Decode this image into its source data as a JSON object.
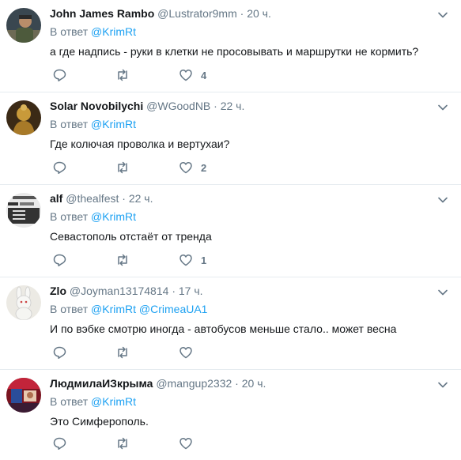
{
  "reply_prefix": "В ответ",
  "tweets": [
    {
      "name": "John James Rambo",
      "handle": "@Lustrator9mm",
      "dot": "·",
      "time": "20 ч.",
      "mentions": [
        "@KrimRt"
      ],
      "text": "а где надпись - руки в клетки не просовывать и маршрутки не кормить?",
      "likes": "4",
      "avatar": "person-in-dark-photo"
    },
    {
      "name": "Solar Novobilychi",
      "handle": "@WGoodNB",
      "dot": "·",
      "time": "22 ч.",
      "mentions": [
        "@KrimRt"
      ],
      "text": "Где колючая проволка и вертухаи?",
      "likes": "2",
      "avatar": "golden-statue"
    },
    {
      "name": "alf",
      "handle": "@thealfest",
      "dot": "·",
      "time": "22 ч.",
      "mentions": [
        "@KrimRt"
      ],
      "text": "Севастополь отстаёт от тренда",
      "likes": "1",
      "avatar": "exchange-rates-board"
    },
    {
      "name": "Zlo",
      "handle": "@Joyman13174814",
      "dot": "·",
      "time": "17 ч.",
      "mentions": [
        "@KrimRt",
        "@CrimeaUA1"
      ],
      "text": "И по вэбке смотрю иногда - автобусов меньше стало.. может весна",
      "likes": "",
      "avatar": "white-rabbit-toy"
    },
    {
      "name": "ЛюдмилаИЗкрыма",
      "handle": "@mangup2332",
      "dot": "·",
      "time": "20 ч.",
      "mentions": [
        "@KrimRt"
      ],
      "text": "Это Симферополь.",
      "likes": "",
      "avatar": "red-blue-collage"
    }
  ]
}
